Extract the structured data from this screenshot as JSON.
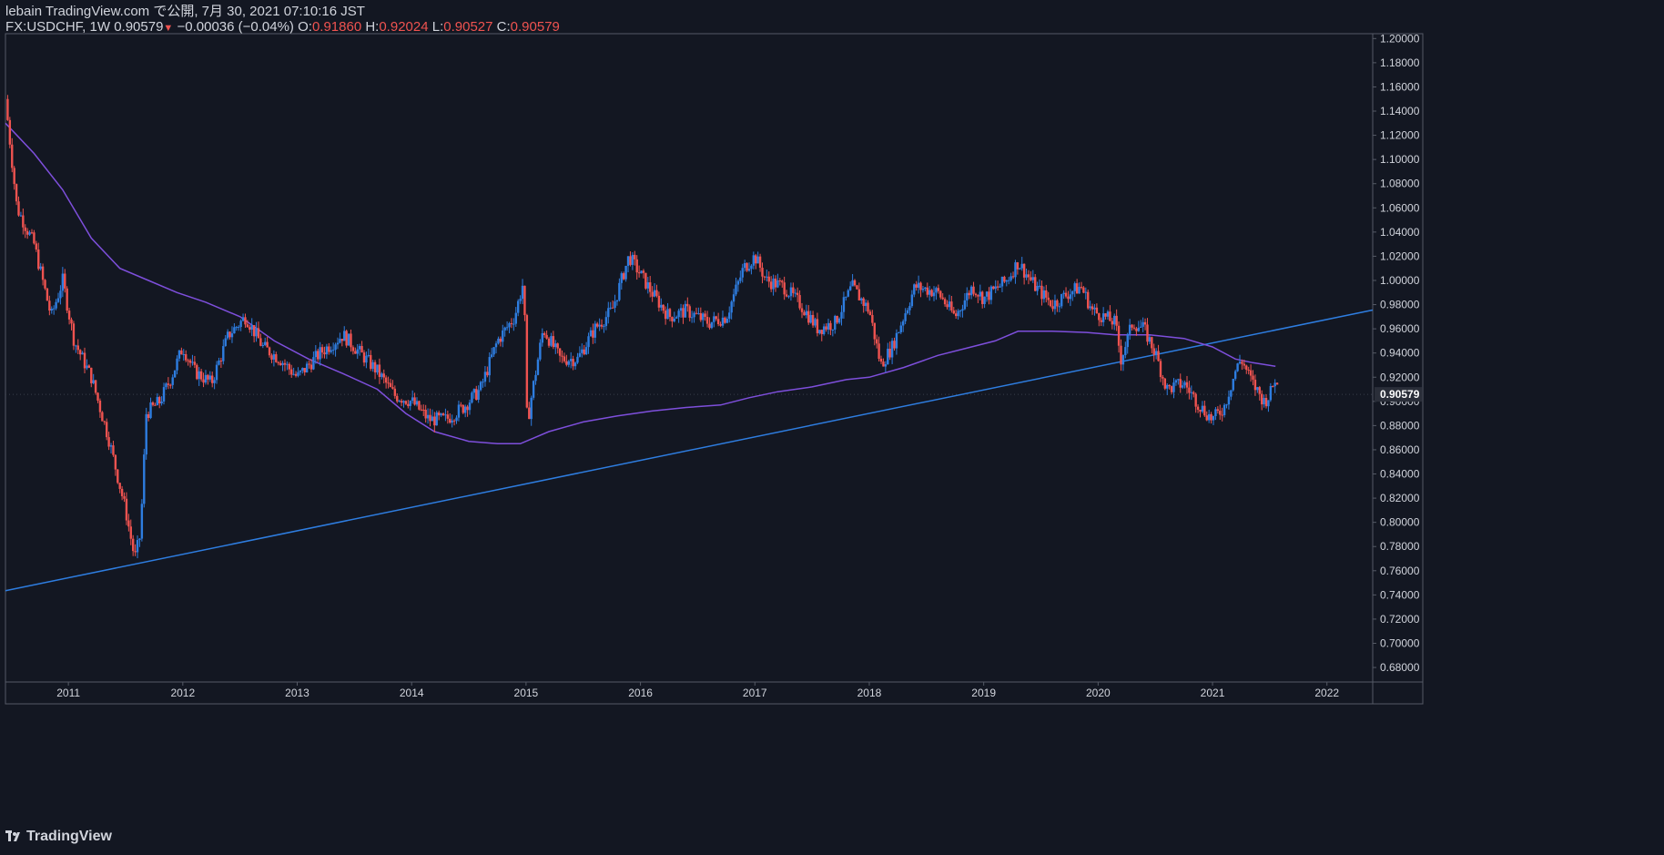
{
  "header": {
    "publisher": "lebain TradingView.com で公開, 7月 30, 2021 07:10:16 JST",
    "symbol": "FX:USDCHF, 1W",
    "last": "0.90579",
    "arrow": "▼",
    "change": "−0.00036 (−0.04%)",
    "open_label": "O:",
    "open": "0.91860",
    "high_label": "H:",
    "high": "0.92024",
    "low_label": "L:",
    "low": "0.90527",
    "close_label": "C:",
    "close": "0.90579"
  },
  "footer": {
    "logo_text": "TradingView",
    "logo_mark": "17"
  },
  "colors": {
    "background": "#131722",
    "up": "#2e7de0",
    "down": "#ef5350",
    "ma": "#7e4fdc",
    "trendline": "#2e7de0",
    "axis_text": "#d1d4dc",
    "border": "#555a66"
  },
  "chart_data": {
    "type": "candlestick",
    "symbol": "FX:USDCHF",
    "timeframe": "1W",
    "ylim": [
      0.668,
      1.204
    ],
    "y_ticks": [
      "0.68000",
      "0.70000",
      "0.72000",
      "0.74000",
      "0.76000",
      "0.78000",
      "0.80000",
      "0.82000",
      "0.84000",
      "0.86000",
      "0.88000",
      "0.90000",
      "0.92000",
      "0.94000",
      "0.96000",
      "0.98000",
      "1.00000",
      "1.02000",
      "1.04000",
      "1.06000",
      "1.08000",
      "1.10000",
      "1.12000",
      "1.14000",
      "1.16000",
      "1.18000",
      "1.20000"
    ],
    "x_ticks": [
      "2011",
      "2012",
      "2013",
      "2014",
      "2015",
      "2016",
      "2017",
      "2018",
      "2019",
      "2020",
      "2021",
      "2022"
    ],
    "x_tick_years": [
      2011,
      2012,
      2013,
      2014,
      2015,
      2016,
      2017,
      2018,
      2019,
      2020,
      2021,
      2022
    ],
    "x_range": [
      2010.45,
      2022.4
    ],
    "last_price_label": "0.90579",
    "last_price": 0.90579,
    "price_path": [
      [
        2010.45,
        1.15
      ],
      [
        2010.55,
        1.06
      ],
      [
        2010.7,
        1.03
      ],
      [
        2010.85,
        0.97
      ],
      [
        2010.95,
        1.0
      ],
      [
        2011.05,
        0.95
      ],
      [
        2011.2,
        0.92
      ],
      [
        2011.35,
        0.87
      ],
      [
        2011.5,
        0.81
      ],
      [
        2011.58,
        0.77
      ],
      [
        2011.63,
        0.79
      ],
      [
        2011.68,
        0.89
      ],
      [
        2011.8,
        0.9
      ],
      [
        2011.9,
        0.92
      ],
      [
        2012.0,
        0.945
      ],
      [
        2012.1,
        0.925
      ],
      [
        2012.25,
        0.915
      ],
      [
        2012.4,
        0.955
      ],
      [
        2012.55,
        0.97
      ],
      [
        2012.7,
        0.945
      ],
      [
        2012.85,
        0.935
      ],
      [
        2013.0,
        0.92
      ],
      [
        2013.2,
        0.94
      ],
      [
        2013.4,
        0.955
      ],
      [
        2013.55,
        0.94
      ],
      [
        2013.7,
        0.925
      ],
      [
        2013.85,
        0.905
      ],
      [
        2014.0,
        0.9
      ],
      [
        2014.15,
        0.885
      ],
      [
        2014.3,
        0.885
      ],
      [
        2014.45,
        0.895
      ],
      [
        2014.6,
        0.91
      ],
      [
        2014.75,
        0.95
      ],
      [
        2014.9,
        0.97
      ],
      [
        2014.98,
        1.0
      ],
      [
        2015.01,
        0.88
      ],
      [
        2015.04,
        0.9
      ],
      [
        2015.15,
        0.96
      ],
      [
        2015.3,
        0.935
      ],
      [
        2015.45,
        0.935
      ],
      [
        2015.6,
        0.96
      ],
      [
        2015.75,
        0.975
      ],
      [
        2015.9,
        1.02
      ],
      [
        2016.0,
        1.005
      ],
      [
        2016.1,
        0.99
      ],
      [
        2016.25,
        0.97
      ],
      [
        2016.4,
        0.975
      ],
      [
        2016.6,
        0.965
      ],
      [
        2016.75,
        0.97
      ],
      [
        2016.9,
        1.01
      ],
      [
        2017.0,
        1.02
      ],
      [
        2017.1,
        1.0
      ],
      [
        2017.25,
        0.995
      ],
      [
        2017.4,
        0.98
      ],
      [
        2017.55,
        0.96
      ],
      [
        2017.7,
        0.965
      ],
      [
        2017.85,
        0.995
      ],
      [
        2018.0,
        0.975
      ],
      [
        2018.1,
        0.93
      ],
      [
        2018.2,
        0.945
      ],
      [
        2018.3,
        0.97
      ],
      [
        2018.4,
        0.995
      ],
      [
        2018.6,
        0.99
      ],
      [
        2018.75,
        0.97
      ],
      [
        2018.9,
        0.995
      ],
      [
        2019.0,
        0.985
      ],
      [
        2019.2,
        1.0
      ],
      [
        2019.3,
        1.015
      ],
      [
        2019.45,
        0.995
      ],
      [
        2019.6,
        0.98
      ],
      [
        2019.75,
        0.99
      ],
      [
        2019.85,
        0.995
      ],
      [
        2019.95,
        0.975
      ],
      [
        2020.05,
        0.97
      ],
      [
        2020.15,
        0.965
      ],
      [
        2020.2,
        0.935
      ],
      [
        2020.3,
        0.965
      ],
      [
        2020.4,
        0.96
      ],
      [
        2020.5,
        0.94
      ],
      [
        2020.6,
        0.91
      ],
      [
        2020.75,
        0.915
      ],
      [
        2020.9,
        0.895
      ],
      [
        2021.0,
        0.885
      ],
      [
        2021.1,
        0.895
      ],
      [
        2021.2,
        0.925
      ],
      [
        2021.25,
        0.935
      ],
      [
        2021.35,
        0.915
      ],
      [
        2021.45,
        0.9
      ],
      [
        2021.5,
        0.905
      ],
      [
        2021.55,
        0.92
      ],
      [
        2021.58,
        0.905
      ]
    ],
    "moving_average": [
      [
        2010.45,
        1.13
      ],
      [
        2010.7,
        1.105
      ],
      [
        2010.95,
        1.075
      ],
      [
        2011.2,
        1.035
      ],
      [
        2011.45,
        1.01
      ],
      [
        2011.7,
        1.0
      ],
      [
        2011.95,
        0.99
      ],
      [
        2012.2,
        0.982
      ],
      [
        2012.5,
        0.97
      ],
      [
        2012.8,
        0.95
      ],
      [
        2013.1,
        0.935
      ],
      [
        2013.4,
        0.923
      ],
      [
        2013.7,
        0.91
      ],
      [
        2013.95,
        0.89
      ],
      [
        2014.2,
        0.875
      ],
      [
        2014.5,
        0.867
      ],
      [
        2014.75,
        0.865
      ],
      [
        2014.95,
        0.865
      ],
      [
        2015.2,
        0.875
      ],
      [
        2015.5,
        0.883
      ],
      [
        2015.8,
        0.888
      ],
      [
        2016.1,
        0.892
      ],
      [
        2016.4,
        0.895
      ],
      [
        2016.7,
        0.897
      ],
      [
        2016.95,
        0.903
      ],
      [
        2017.2,
        0.908
      ],
      [
        2017.5,
        0.912
      ],
      [
        2017.8,
        0.918
      ],
      [
        2018.0,
        0.92
      ],
      [
        2018.3,
        0.928
      ],
      [
        2018.6,
        0.938
      ],
      [
        2018.85,
        0.944
      ],
      [
        2019.1,
        0.95
      ],
      [
        2019.3,
        0.958
      ],
      [
        2019.6,
        0.958
      ],
      [
        2019.9,
        0.957
      ],
      [
        2020.15,
        0.955
      ],
      [
        2020.45,
        0.955
      ],
      [
        2020.75,
        0.952
      ],
      [
        2021.0,
        0.945
      ],
      [
        2021.2,
        0.935
      ],
      [
        2021.35,
        0.932
      ],
      [
        2021.55,
        0.929
      ]
    ],
    "trendline": {
      "x": [
        2010.45,
        2022.4
      ],
      "y": [
        0.7435,
        0.9755
      ]
    }
  }
}
